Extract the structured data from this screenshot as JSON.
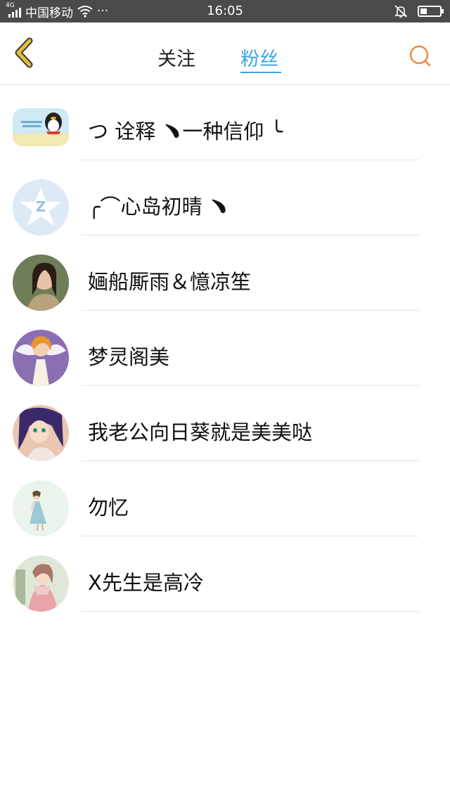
{
  "status_bar": {
    "network": "4G",
    "carrier": "中国移动",
    "more": "···",
    "time": "16:05"
  },
  "nav": {
    "tabs": [
      {
        "label": "关注",
        "active": false
      },
      {
        "label": "粉丝",
        "active": true
      }
    ],
    "accent_color": "#3aa3e0",
    "back_icon_color": "#d9b12a",
    "search_icon_color": "#f08a3c"
  },
  "followers": [
    {
      "name": "つ 诠释 ﹅一种信仰 ╰"
    },
    {
      "name": "╭⌒心岛初晴 ﹅"
    },
    {
      "name": "婳船厮雨＆憶凉笙"
    },
    {
      "name": "梦灵阁美"
    },
    {
      "name": "我老公向日葵就是美美哒"
    },
    {
      "name": "勿忆"
    },
    {
      "name": "X先生是高冷"
    }
  ]
}
